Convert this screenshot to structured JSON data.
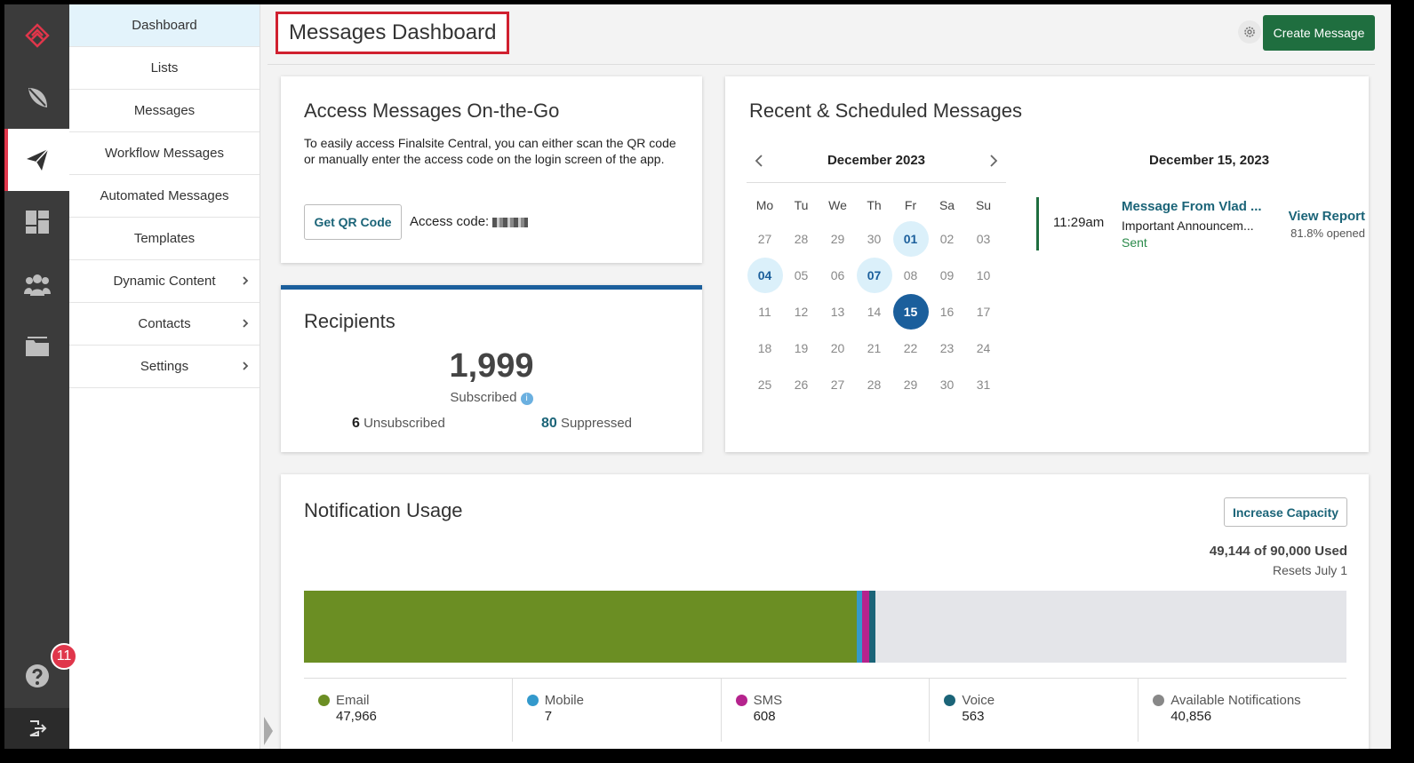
{
  "rail": {
    "badge_count": "11"
  },
  "subnav": {
    "items": [
      {
        "label": "Dashboard"
      },
      {
        "label": "Lists"
      },
      {
        "label": "Messages"
      },
      {
        "label": "Workflow Messages"
      },
      {
        "label": "Automated Messages"
      },
      {
        "label": "Templates"
      },
      {
        "label": "Dynamic Content"
      },
      {
        "label": "Contacts"
      },
      {
        "label": "Settings"
      }
    ]
  },
  "header": {
    "title": "Messages Dashboard",
    "create_label": "Create Message"
  },
  "access": {
    "title": "Access Messages On-the-Go",
    "description": "To easily access Finalsite Central, you can either scan the QR code or manually enter the access code on the login screen of the app.",
    "qr_label": "Get QR Code",
    "code_label": "Access code:"
  },
  "recipients": {
    "title": "Recipients",
    "subscribed_count": "1,999",
    "subscribed_label": "Subscribed",
    "unsubscribed_count": "6",
    "unsubscribed_label": "Unsubscribed",
    "suppressed_count": "80",
    "suppressed_label": "Suppressed"
  },
  "schedule": {
    "title": "Recent & Scheduled Messages",
    "month": "December 2023",
    "weekdays": [
      "Mo",
      "Tu",
      "We",
      "Th",
      "Fr",
      "Sa",
      "Su"
    ],
    "days": [
      "27",
      "28",
      "29",
      "30",
      "01",
      "02",
      "03",
      "04",
      "05",
      "06",
      "07",
      "08",
      "09",
      "10",
      "11",
      "12",
      "13",
      "14",
      "15",
      "16",
      "17",
      "18",
      "19",
      "20",
      "21",
      "22",
      "23",
      "24",
      "25",
      "26",
      "27",
      "28",
      "29",
      "30",
      "31"
    ],
    "marked_days": [
      "01",
      "04",
      "07"
    ],
    "selected_day": "15",
    "selected_date": "December 15, 2023",
    "message": {
      "time": "11:29am",
      "title": "Message From Vlad ...",
      "subject": "Important Announcem...",
      "status": "Sent",
      "report_label": "View Report",
      "opened": "81.8% opened"
    }
  },
  "usage": {
    "title": "Notification Usage",
    "capacity_label": "Increase Capacity",
    "used": "49,144 of 90,000 Used",
    "resets": "Resets July 1",
    "total": 90000,
    "segments": [
      {
        "name": "Email",
        "value": "47,966",
        "amount": 47966,
        "color": "#6b8e23"
      },
      {
        "name": "Mobile",
        "value": "7",
        "amount": 7,
        "color": "#3399cc"
      },
      {
        "name": "SMS",
        "value": "608",
        "amount": 608,
        "color": "#b5238d"
      },
      {
        "name": "Voice",
        "value": "563",
        "amount": 563,
        "color": "#1b6478"
      },
      {
        "name": "Available Notifications",
        "value": "40,856",
        "amount": 40856,
        "color": "#e4e5e9",
        "dot_color": "#888888"
      }
    ]
  }
}
